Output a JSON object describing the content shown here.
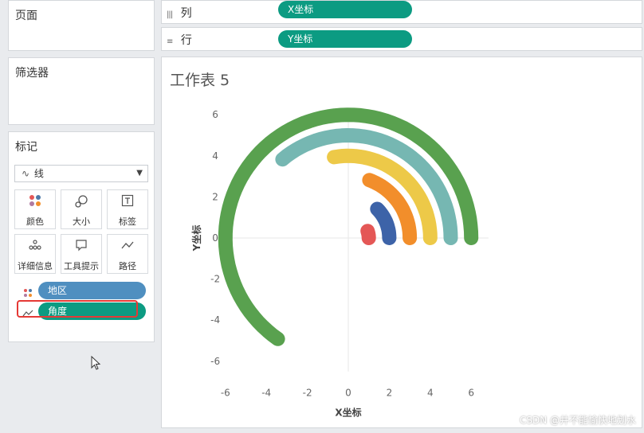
{
  "pages": {
    "title": "页面"
  },
  "filters": {
    "title": "筛选器"
  },
  "marks": {
    "title": "标记",
    "type": {
      "icon": "line-icon",
      "label": "线"
    },
    "buttons": [
      {
        "icon": "color-icon",
        "label": "颜色"
      },
      {
        "icon": "size-icon",
        "label": "大小"
      },
      {
        "icon": "label-icon",
        "label": "标签"
      },
      {
        "icon": "detail-icon",
        "label": "详细信息"
      },
      {
        "icon": "tooltip-icon",
        "label": "工具提示"
      },
      {
        "icon": "path-icon",
        "label": "路径"
      }
    ],
    "fields": [
      {
        "icon": "color-icon",
        "label": "地区",
        "color": "#4f8fc0"
      },
      {
        "icon": "path-icon",
        "label": "角度",
        "color": "#0c9b82",
        "highlight": "#e53935"
      }
    ]
  },
  "shelves": {
    "columns": {
      "label": "列",
      "icon": "columns-icon",
      "pill": "X坐标"
    },
    "rows": {
      "label": "行",
      "icon": "rows-icon",
      "pill": "Y坐标"
    }
  },
  "sheet": {
    "title": "工作表 5"
  },
  "chart_data": {
    "type": "line",
    "xlabel": "X坐标",
    "ylabel": "Y坐标",
    "xlim": [
      -7,
      7
    ],
    "ylim": [
      -6.5,
      6.5
    ],
    "xticks": [
      -6,
      -4,
      -2,
      0,
      2,
      4,
      6
    ],
    "yticks": [
      6,
      4,
      2,
      0,
      -2,
      -4,
      -6
    ],
    "grid": false,
    "series": [
      {
        "color": "#e45756",
        "radius": 1.0,
        "end_angle_deg": 20
      },
      {
        "color": "#3d63a8",
        "radius": 2.0,
        "end_angle_deg": 45
      },
      {
        "color": "#f28e2b",
        "radius": 3.0,
        "end_angle_deg": 70
      },
      {
        "color": "#edc948",
        "radius": 4.0,
        "end_angle_deg": 100
      },
      {
        "color": "#76b7b2",
        "radius": 5.0,
        "end_angle_deg": 130
      },
      {
        "color": "#59a14f",
        "radius": 6.0,
        "end_angle_deg": 235
      }
    ]
  },
  "watermark": "CSDN @井不能愉快地划水"
}
